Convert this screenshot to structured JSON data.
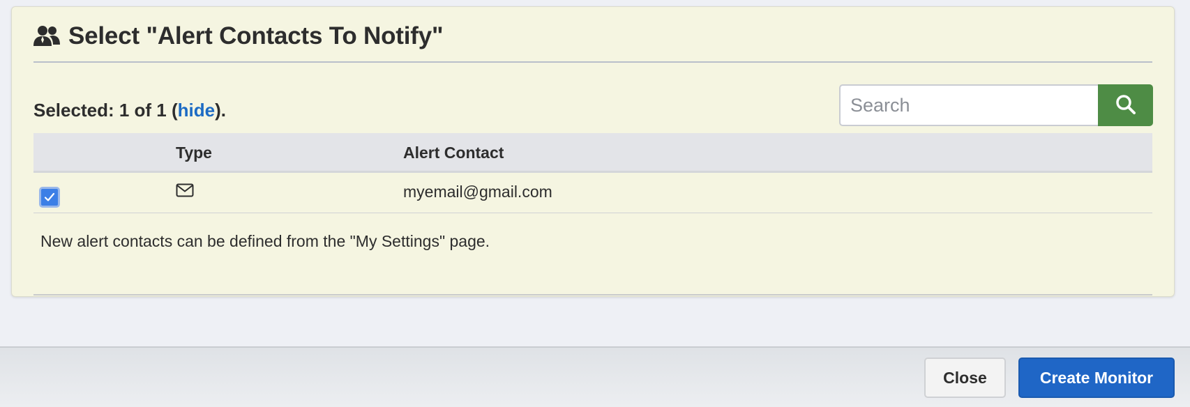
{
  "panel": {
    "title": "Select \"Alert Contacts To Notify\"",
    "title_icon": "users-icon"
  },
  "selection": {
    "prefix": "Selected: 1 of 1 (",
    "toggle_label": "hide",
    "suffix": ")."
  },
  "search": {
    "placeholder": "Search",
    "value": "",
    "button_icon": "search-icon"
  },
  "table": {
    "columns": [
      "",
      "Type",
      "Alert Contact"
    ],
    "rows": [
      {
        "checked": true,
        "type_icon": "envelope-icon",
        "contact": "myemail@gmail.com"
      }
    ]
  },
  "note": "New alert contacts can be defined from the \"My Settings\" page.",
  "footer": {
    "close_label": "Close",
    "create_label": "Create Monitor"
  },
  "colors": {
    "panel_bg": "#f5f5e1",
    "link": "#1d6bc4",
    "search_button": "#4e8c45",
    "primary_button": "#1f66c6",
    "checkbox": "#3c7fe6"
  }
}
